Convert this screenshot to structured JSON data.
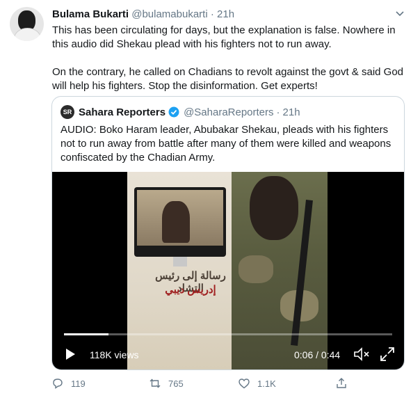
{
  "tweet": {
    "author_name": "Bulama Bukarti",
    "author_handle": "@bulamabukarti",
    "separator": "·",
    "time": "21h",
    "text": "This has been circulating for days, but the explanation is false. Nowhere in this audio did Shekau plead with his fighters not to run away.\n\nOn the contrary, he called on Chadians to revolt against the govt & said God will help his fighters. Stop the disinformation. Get experts!"
  },
  "quote": {
    "logo_text": "SR",
    "author_name": "Sahara Reporters",
    "author_handle": "@SaharaReporters",
    "separator": "·",
    "time": "21h",
    "text": "AUDIO: Boko Haram leader, Abubakar Shekau, pleads with his fighters not to run away from battle after many of them were killed and weapons confiscated by the Chadian Army.",
    "video": {
      "arabic_line1": "رسالة إلى رئيس التشاد",
      "arabic_line2": "إدريس ديبي",
      "views": "118K views",
      "timecode": "0:06 / 0:44",
      "progress_fraction": 0.136
    }
  },
  "actions": {
    "reply_count": "119",
    "retweet_count": "765",
    "like_count": "1.1K"
  },
  "colors": {
    "text": "#14171a",
    "secondary": "#657786",
    "border": "#ccd6dd",
    "verified": "#1da1f2"
  }
}
